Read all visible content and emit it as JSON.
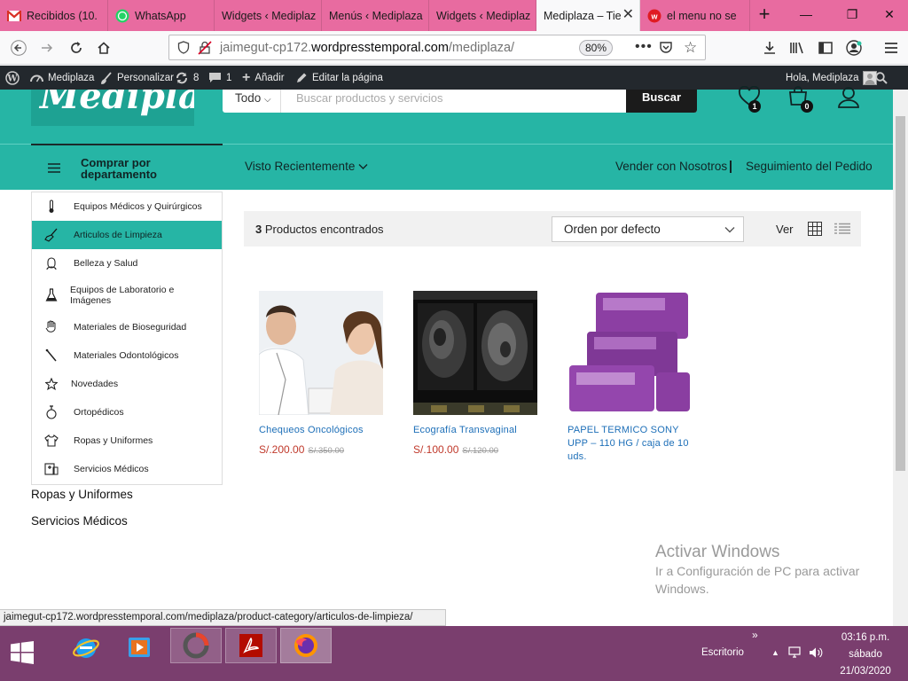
{
  "browser": {
    "tabs": [
      {
        "label": "Recibidos (10.",
        "icon": "gmail-icon",
        "active": false
      },
      {
        "label": "WhatsApp",
        "icon": "whatsapp-icon",
        "active": false
      },
      {
        "label": "Widgets ‹ Mediplaz",
        "icon": "wordpress-icon",
        "active": false
      },
      {
        "label": "Menús ‹ Mediplaza",
        "icon": "wordpress-icon",
        "active": false
      },
      {
        "label": "Widgets ‹ Mediplaz",
        "icon": "wordpress-icon",
        "active": false
      },
      {
        "label": "Mediplaza – Tie",
        "icon": "none",
        "active": true
      },
      {
        "label": "el menu no se",
        "icon": "w-icon",
        "active": false
      }
    ],
    "url_host": "jaimegut-cp172.",
    "url_domain": "wordpresstemporal.com",
    "url_path": "/mediplaza/",
    "zoom": "80%",
    "status_url": "jaimegut-cp172.wordpresstemporal.com/mediplaza/product-category/articulos-de-limpieza/"
  },
  "adminbar": {
    "site": "Mediplaza",
    "customize": "Personalizar",
    "updates": "8",
    "comments": "1",
    "add": "Añadir",
    "edit": "Editar la página",
    "greeting": "Hola, Mediplaza"
  },
  "header": {
    "logo": "Mediplaza",
    "search_category": "Todo",
    "search_placeholder": "Buscar productos y servicios",
    "search_button": "Buscar",
    "wishlist_count": "1",
    "cart_count": "0",
    "dept_label_1": "Comprar por",
    "dept_label_2": "departamento",
    "recent": "Visto Recientemente",
    "sell": "Vender con Nosotros",
    "tracking": "Seguimiento del Pedido"
  },
  "sidebar": {
    "items": [
      {
        "label": "Equipos Médicos y Quirúrgicos",
        "icon": "thermometer-icon"
      },
      {
        "label": "Articulos de Limpieza",
        "icon": "broom-icon",
        "active": true
      },
      {
        "label": "Belleza y Salud",
        "icon": "face-icon"
      },
      {
        "label": "Equipos de Laboratorio e Imágenes",
        "icon": "flask-icon"
      },
      {
        "label": "Materiales de Bioseguridad",
        "icon": "hand-icon"
      },
      {
        "label": "Materiales Odontológicos",
        "icon": "dental-tool-icon"
      },
      {
        "label": "Novedades",
        "icon": "star-icon"
      },
      {
        "label": "Ortopédicos",
        "icon": "orthopedic-icon"
      },
      {
        "label": "Ropas y Uniformes",
        "icon": "shirt-icon"
      },
      {
        "label": "Servicios Médicos",
        "icon": "medical-service-icon"
      }
    ],
    "below": [
      "Ropas y Uniformes",
      "Servicios Médicos"
    ]
  },
  "toolbar": {
    "count_number": "3",
    "count_text": "Productos encontrados",
    "sort": "Orden por defecto",
    "view_label": "Ver"
  },
  "products": [
    {
      "title": "Chequeos Oncológicos",
      "price": "S/.200.00",
      "old_price": "S/.350.00"
    },
    {
      "title": "Ecografía Transvaginal",
      "price": "S/.100.00",
      "old_price": "S/.120.00"
    },
    {
      "title": "PAPEL TERMICO SONY UPP – 110 HG / caja de 10 uds.",
      "price": "",
      "old_price": ""
    }
  ],
  "watermark": {
    "title": "Activar Windows",
    "subtitle": "Ir a Configuración de PC para activar Windows."
  },
  "taskbar": {
    "desktop_label": "Escritorio",
    "time": "03:16 p.m.",
    "day": "sábado",
    "date": "21/03/2020"
  },
  "colors": {
    "brand_teal": "#26b5a5",
    "tab_strip": "#e86ba0",
    "taskbar": "#7a3e6e",
    "price_red": "#c0392b",
    "link_blue": "#1d6fb8"
  }
}
